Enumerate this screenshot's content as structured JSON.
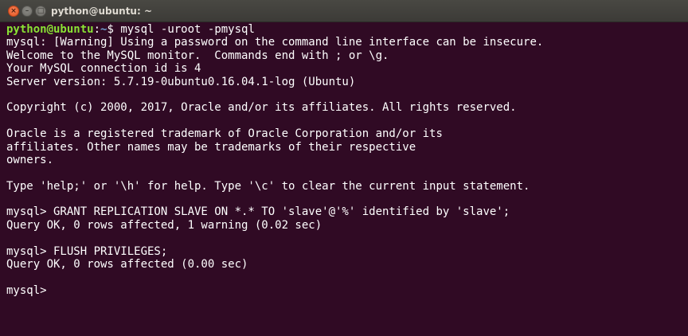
{
  "window": {
    "title": "python@ubuntu: ~",
    "close_glyph": "×",
    "minimize_glyph": "–",
    "maximize_glyph": "□"
  },
  "terminal": {
    "shell_prompt": {
      "user_host": "python@ubuntu",
      "separator": ":",
      "path": "~",
      "symbol": "$ ",
      "command": "mysql -uroot -pmysql"
    },
    "lines": [
      "mysql: [Warning] Using a password on the command line interface can be insecure.",
      "Welcome to the MySQL monitor.  Commands end with ; or \\g.",
      "Your MySQL connection id is 4",
      "Server version: 5.7.19-0ubuntu0.16.04.1-log (Ubuntu)",
      "",
      "Copyright (c) 2000, 2017, Oracle and/or its affiliates. All rights reserved.",
      "",
      "Oracle is a registered trademark of Oracle Corporation and/or its",
      "affiliates. Other names may be trademarks of their respective",
      "owners.",
      "",
      "Type 'help;' or '\\h' for help. Type '\\c' to clear the current input statement.",
      "",
      "mysql> GRANT REPLICATION SLAVE ON *.* TO 'slave'@'%' identified by 'slave';",
      "Query OK, 0 rows affected, 1 warning (0.02 sec)",
      "",
      "mysql> FLUSH PRIVILEGES;",
      "Query OK, 0 rows affected (0.00 sec)",
      "",
      "mysql> "
    ]
  }
}
